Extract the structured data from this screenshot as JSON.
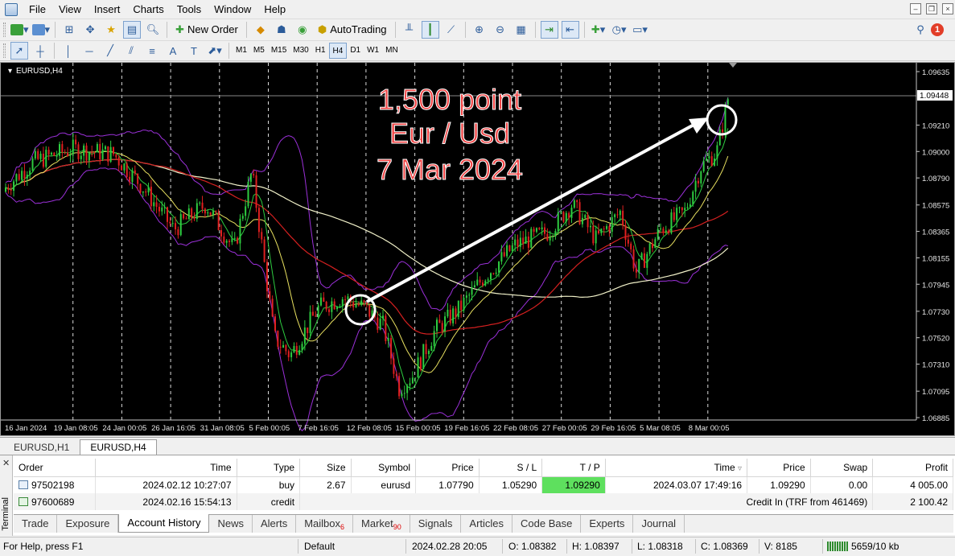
{
  "menu": [
    "File",
    "View",
    "Insert",
    "Charts",
    "Tools",
    "Window",
    "Help"
  ],
  "toolbar": {
    "new_order": "New Order",
    "autotrading": "AutoTrading",
    "notification_count": "1"
  },
  "timeframes": [
    "M1",
    "M5",
    "M15",
    "M30",
    "H1",
    "H4",
    "D1",
    "W1",
    "MN"
  ],
  "selected_timeframe": "H4",
  "chart": {
    "symbol_label": "EURUSD,H4",
    "current_price": "1.09448",
    "annotation_lines": [
      "1,500 point",
      "Eur / Usd",
      "7 Mar 2024"
    ],
    "annotation_color": "#f04545",
    "price_ticks": [
      "1.09635",
      "1.09210",
      "1.09000",
      "1.08790",
      "1.08575",
      "1.08365",
      "1.08155",
      "1.07945",
      "1.07730",
      "1.07520",
      "1.07310",
      "1.07095",
      "1.06885"
    ],
    "time_ticks": [
      "16 Jan 2024",
      "19 Jan 08:05",
      "24 Jan 00:05",
      "26 Jan 16:05",
      "31 Jan 08:05",
      "5 Feb 00:05",
      "7 Feb 16:05",
      "12 Feb 08:05",
      "15 Feb 00:05",
      "19 Feb 16:05",
      "22 Feb 08:05",
      "27 Feb 00:05",
      "29 Feb 16:05",
      "5 Mar 08:05",
      "8 Mar 00:05"
    ],
    "bull_color": "#2ecc40",
    "bear_color": "#e02020"
  },
  "chart_tabs": [
    "EURUSD,H1",
    "EURUSD,H4"
  ],
  "active_chart_tab": "EURUSD,H4",
  "orders": {
    "columns": [
      "Order",
      "Time",
      "Type",
      "Size",
      "Symbol",
      "Price",
      "S / L",
      "T / P",
      "Time",
      "Price",
      "Swap",
      "Profit"
    ],
    "rows": [
      {
        "order": "97502198",
        "time": "2024.02.12 10:27:07",
        "type": "buy",
        "size": "2.67",
        "symbol": "eurusd",
        "price": "1.07790",
        "sl": "1.05290",
        "tp": "1.09290",
        "close_time": "2024.03.07 17:49:16",
        "close_price": "1.09290",
        "swap": "0.00",
        "profit": "4 005.00"
      },
      {
        "order": "97600689",
        "time": "2024.02.16 15:54:13",
        "type": "credit",
        "comment": "Credit In (TRF from 461469)",
        "profit": "2 100.42"
      }
    ]
  },
  "terminal": {
    "label": "Terminal",
    "tabs": [
      {
        "label": "Trade"
      },
      {
        "label": "Exposure"
      },
      {
        "label": "Account History"
      },
      {
        "label": "News"
      },
      {
        "label": "Alerts"
      },
      {
        "label": "Mailbox",
        "badge": "6"
      },
      {
        "label": "Market",
        "badge": "90"
      },
      {
        "label": "Signals"
      },
      {
        "label": "Articles"
      },
      {
        "label": "Code Base"
      },
      {
        "label": "Experts"
      },
      {
        "label": "Journal"
      }
    ],
    "active_tab": "Account History"
  },
  "status": {
    "help": "For Help, press F1",
    "profile": "Default",
    "datetime": "2024.02.28 20:05",
    "open": "O: 1.08382",
    "high": "H: 1.08397",
    "low": "L: 1.08318",
    "close": "C: 1.08369",
    "volume": "V: 8185",
    "traffic": "5659/10 kb"
  }
}
